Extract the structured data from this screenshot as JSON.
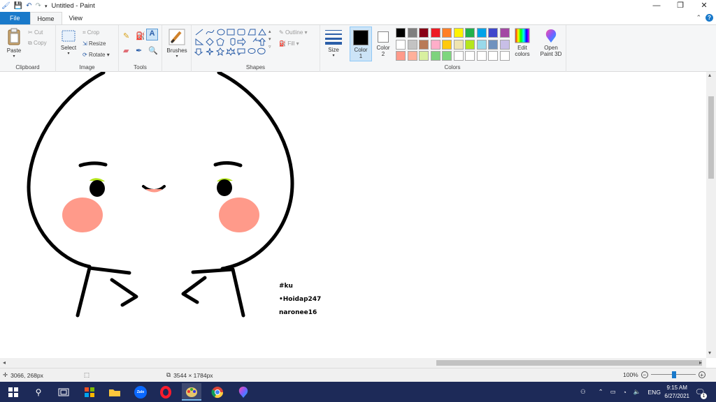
{
  "window": {
    "title": "Untitled - Paint",
    "controls": {
      "minimize": "—",
      "restore": "❐",
      "close": "✕"
    }
  },
  "tabs": [
    {
      "label": "File"
    },
    {
      "label": "Home"
    },
    {
      "label": "View"
    }
  ],
  "ribbon": {
    "clipboard": {
      "group_label": "Clipboard",
      "paste": "Paste",
      "cut": "Cut",
      "copy": "Copy"
    },
    "image": {
      "group_label": "Image",
      "select": "Select",
      "crop": "Crop",
      "resize": "Resize",
      "rotate": "Rotate"
    },
    "tools": {
      "group_label": "Tools"
    },
    "brushes": {
      "label": "Brushes"
    },
    "shapes": {
      "group_label": "Shapes",
      "outline": "Outline",
      "fill": "Fill"
    },
    "size": {
      "label": "Size"
    },
    "color1": {
      "label": "Color",
      "sub": "1",
      "value": "#000000"
    },
    "color2": {
      "label": "Color",
      "sub": "2",
      "value": "#ffffff"
    },
    "colors": {
      "group_label": "Colors",
      "row1": [
        "#000000",
        "#7f7f7f",
        "#880015",
        "#ed1c24",
        "#ff7f27",
        "#fff200",
        "#22b14c",
        "#00a2e8",
        "#3f48cc",
        "#a349a4"
      ],
      "row2": [
        "#ffffff",
        "#c3c3c3",
        "#b97a57",
        "#ffaec9",
        "#ffc90e",
        "#efe4b0",
        "#b5e61d",
        "#99d9ea",
        "#7092be",
        "#c8bfe7"
      ],
      "row3": [
        "#ff9a8a",
        "#ffb09a",
        "#d8f0a0",
        "#7dd37d",
        "#7ed67e",
        "#ffffff",
        "#ffffff",
        "#ffffff",
        "#ffffff",
        "#ffffff"
      ]
    },
    "edit_colors": {
      "line1": "Edit",
      "line2": "colors"
    },
    "paint3d": {
      "line1": "Open",
      "line2": "Paint 3D"
    }
  },
  "canvas": {
    "signature_lines": [
      "#ku",
      "•Hoidap247",
      "naronee16"
    ]
  },
  "statusbar": {
    "cursor_pos": "3066, 268px",
    "image_size": "3544 × 1784px",
    "zoom": "100%"
  },
  "taskbar": {
    "time": "9:15 AM",
    "date": "6/27/2021",
    "lang": "ENG",
    "notification_count": "1",
    "zalo_label": "Zalo"
  }
}
